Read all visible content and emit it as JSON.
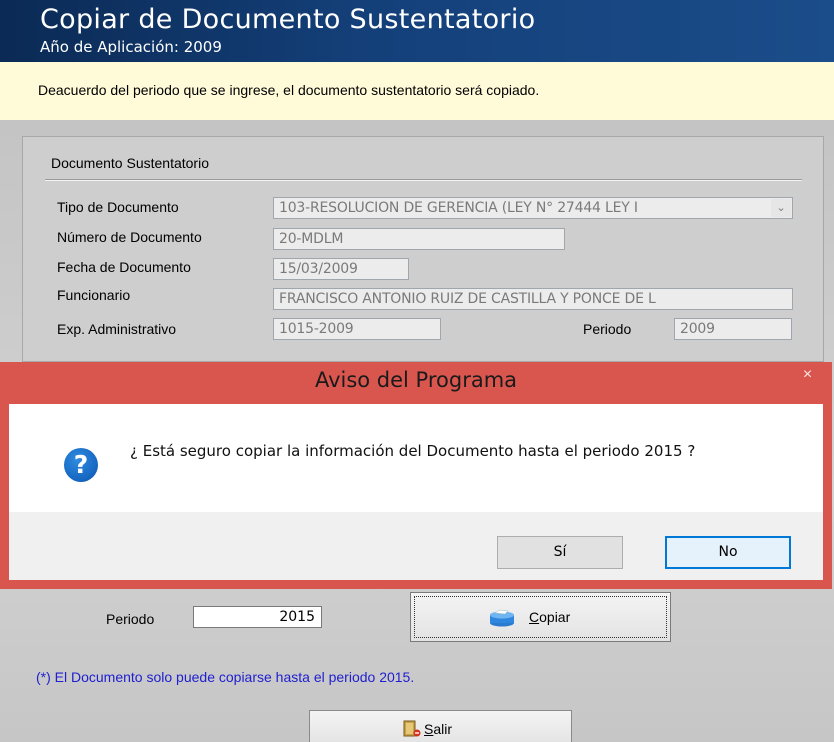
{
  "header": {
    "title": "Copiar de Documento Sustentatorio",
    "subtitle": "Año de Aplicación: 2009"
  },
  "info": {
    "text": "Deacuerdo del periodo que se ingrese, el documento sustentatorio será copiado."
  },
  "group": {
    "title": "Documento Sustentatorio",
    "fields": {
      "tipo_label": "Tipo de Documento",
      "tipo_value": "103-RESOLUCION DE GERENCIA (LEY N° 27444 LEY I",
      "numero_label": "Número de Documento",
      "numero_value": "20-MDLM",
      "fecha_label": "Fecha de Documento",
      "fecha_value": "15/03/2009",
      "funcionario_label": "Funcionario",
      "funcionario_value": "FRANCISCO ANTONIO RUIZ DE CASTILLA Y PONCE DE L",
      "expediente_label": "Exp. Administrativo",
      "expediente_value": "1015-2009",
      "periodo_label": "Periodo",
      "periodo_value": "2009"
    }
  },
  "dialog": {
    "title": "Aviso del Programa",
    "close": "×",
    "icon": "question-icon",
    "icon_glyph": "?",
    "message": "¿ Está seguro copiar la información del Documento hasta el periodo 2015 ?",
    "yes": "Sí",
    "no": "No",
    "accent": "#d9564f"
  },
  "bottom": {
    "periodo_label": "Periodo",
    "periodo_value": "2015",
    "copiar_mnemonic": "C",
    "copiar_rest": "opiar",
    "note": "(*) El Documento solo puede copiarse hasta el periodo 2015.",
    "salir_mnemonic": "S",
    "salir_rest": "alir"
  },
  "icons": {
    "copiar": "copy-stack-icon",
    "salir": "exit-door-icon"
  }
}
